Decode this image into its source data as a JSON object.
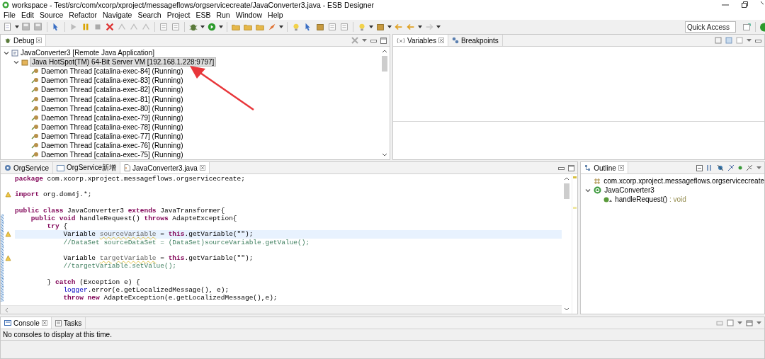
{
  "window": {
    "title": "workspace - Test/src/com/xcorp/xproject/messageflows/orgservicecreate/JavaConverter3.java - ESB Designer"
  },
  "menu": [
    "File",
    "Edit",
    "Source",
    "Refactor",
    "Navigate",
    "Search",
    "Project",
    "ESB",
    "Run",
    "Window",
    "Help"
  ],
  "quick_access": {
    "placeholder": "Quick Access"
  },
  "debug_panel": {
    "tabs": [
      {
        "label": "Debug",
        "selected": true
      }
    ],
    "tree": [
      {
        "label": "JavaConverter3 [Remote Java Application]",
        "selected": false,
        "expanded": true,
        "children": [
          {
            "label": "Java HotSpot(TM) 64-Bit Server VM [192.168.1.228:9797]",
            "selected": true,
            "expanded": true,
            "children": [
              {
                "label": "Daemon Thread [catalina-exec-84] (Running)",
                "selected": false
              },
              {
                "label": "Daemon Thread [catalina-exec-83] (Running)",
                "selected": false
              },
              {
                "label": "Daemon Thread [catalina-exec-82] (Running)",
                "selected": false
              },
              {
                "label": "Daemon Thread [catalina-exec-81] (Running)",
                "selected": false
              },
              {
                "label": "Daemon Thread [catalina-exec-80] (Running)",
                "selected": false
              },
              {
                "label": "Daemon Thread [catalina-exec-79] (Running)",
                "selected": false
              },
              {
                "label": "Daemon Thread [catalina-exec-78] (Running)",
                "selected": false
              },
              {
                "label": "Daemon Thread [catalina-exec-77] (Running)",
                "selected": false
              },
              {
                "label": "Daemon Thread [catalina-exec-76] (Running)",
                "selected": false
              },
              {
                "label": "Daemon Thread [catalina-exec-75] (Running)",
                "selected": false
              }
            ]
          }
        ]
      }
    ]
  },
  "variables_panel": {
    "tabs": [
      {
        "label": "Variables",
        "selected": true
      },
      {
        "label": "Breakpoints",
        "selected": false
      }
    ]
  },
  "editor": {
    "tabs": [
      {
        "label": "OrgService",
        "selected": false
      },
      {
        "label": "OrgService新增",
        "selected": false
      },
      {
        "label": "JavaConverter3.java",
        "selected": true
      }
    ],
    "lines": [
      {
        "current": false,
        "warning": false,
        "changed": false,
        "tokens": [
          {
            "text": "package",
            "kind": "keyword"
          },
          {
            "text": " com.xcorp.xproject.messageflows.orgservicecreate;",
            "kind": "plain"
          }
        ]
      },
      {
        "current": false,
        "warning": false,
        "changed": false
      },
      {
        "current": false,
        "warning": true,
        "changed": false,
        "tokens": [
          {
            "text": "import",
            "kind": "keyword"
          },
          {
            "text": " org.dom4j.*;",
            "kind": "plain"
          }
        ]
      },
      {
        "current": false,
        "warning": false,
        "changed": false
      },
      {
        "current": false,
        "warning": false,
        "changed": false,
        "tokens": [
          {
            "text": "public class",
            "kind": "keyword"
          },
          {
            "text": " JavaConverter3 ",
            "kind": "plain"
          },
          {
            "text": "extends",
            "kind": "keyword"
          },
          {
            "text": " JavaTransformer{",
            "kind": "plain"
          }
        ]
      },
      {
        "current": false,
        "warning": false,
        "changed": true,
        "tokens": [
          {
            "text": "    public void",
            "kind": "keyword"
          },
          {
            "text": " handleRequest() ",
            "kind": "plain"
          },
          {
            "text": "throws",
            "kind": "keyword"
          },
          {
            "text": " AdapteException{",
            "kind": "plain"
          }
        ]
      },
      {
        "current": false,
        "warning": false,
        "changed": true,
        "tokens": [
          {
            "text": "        try",
            "kind": "keyword"
          },
          {
            "text": " {",
            "kind": "plain"
          }
        ]
      },
      {
        "current": true,
        "warning": true,
        "changed": true,
        "tokens": [
          {
            "text": "            Variable ",
            "kind": "plain"
          },
          {
            "text": "sourceVariable",
            "kind": "unused"
          },
          {
            "text": " = ",
            "kind": "plain"
          },
          {
            "text": "this",
            "kind": "keyword"
          },
          {
            "text": ".getVariable(\"\");",
            "kind": "plain"
          }
        ]
      },
      {
        "current": false,
        "warning": false,
        "changed": true,
        "tokens": [
          {
            "text": "            //DataSet sourceDataSet = (DataSet)sourceVariable.getValue();",
            "kind": "comment"
          }
        ]
      },
      {
        "current": false,
        "warning": false,
        "changed": true
      },
      {
        "current": false,
        "warning": true,
        "changed": true,
        "tokens": [
          {
            "text": "            Variable ",
            "kind": "plain"
          },
          {
            "text": "targetVariable",
            "kind": "unused"
          },
          {
            "text": " = ",
            "kind": "plain"
          },
          {
            "text": "this",
            "kind": "keyword"
          },
          {
            "text": ".getVariable(\"\");",
            "kind": "plain"
          }
        ]
      },
      {
        "current": false,
        "warning": false,
        "changed": true,
        "tokens": [
          {
            "text": "            //targetVariable.setValue();",
            "kind": "comment"
          }
        ]
      },
      {
        "current": false,
        "warning": false,
        "changed": true
      },
      {
        "current": false,
        "warning": false,
        "changed": true,
        "tokens": [
          {
            "text": "        } ",
            "kind": "plain"
          },
          {
            "text": "catch",
            "kind": "keyword"
          },
          {
            "text": " (Exception e) {",
            "kind": "plain"
          }
        ]
      },
      {
        "current": false,
        "warning": false,
        "changed": true,
        "tokens": [
          {
            "text": "            logger",
            "kind": "field"
          },
          {
            "text": ".error(e.getLocalizedMessage(), e);",
            "kind": "plain"
          }
        ]
      },
      {
        "current": false,
        "warning": false,
        "changed": true,
        "tokens": [
          {
            "text": "            throw new",
            "kind": "keyword"
          },
          {
            "text": " AdapteException(e.getLocalizedMessage(),e);",
            "kind": "plain"
          }
        ]
      }
    ]
  },
  "outline_panel": {
    "tabs": [
      {
        "label": "Outline",
        "selected": true
      }
    ],
    "tree": [
      {
        "kind": "package",
        "label": "com.xcorp.xproject.messageflows.orgservicecreate"
      },
      {
        "kind": "class",
        "label": "JavaConverter3",
        "expanded": true,
        "children": [
          {
            "kind": "method",
            "label": "handleRequest()",
            "return_type": " : void"
          }
        ]
      }
    ]
  },
  "console_panel": {
    "tabs": [
      {
        "label": "Console",
        "selected": true
      },
      {
        "label": "Tasks",
        "selected": false
      }
    ],
    "message": "No consoles to display at this time."
  }
}
